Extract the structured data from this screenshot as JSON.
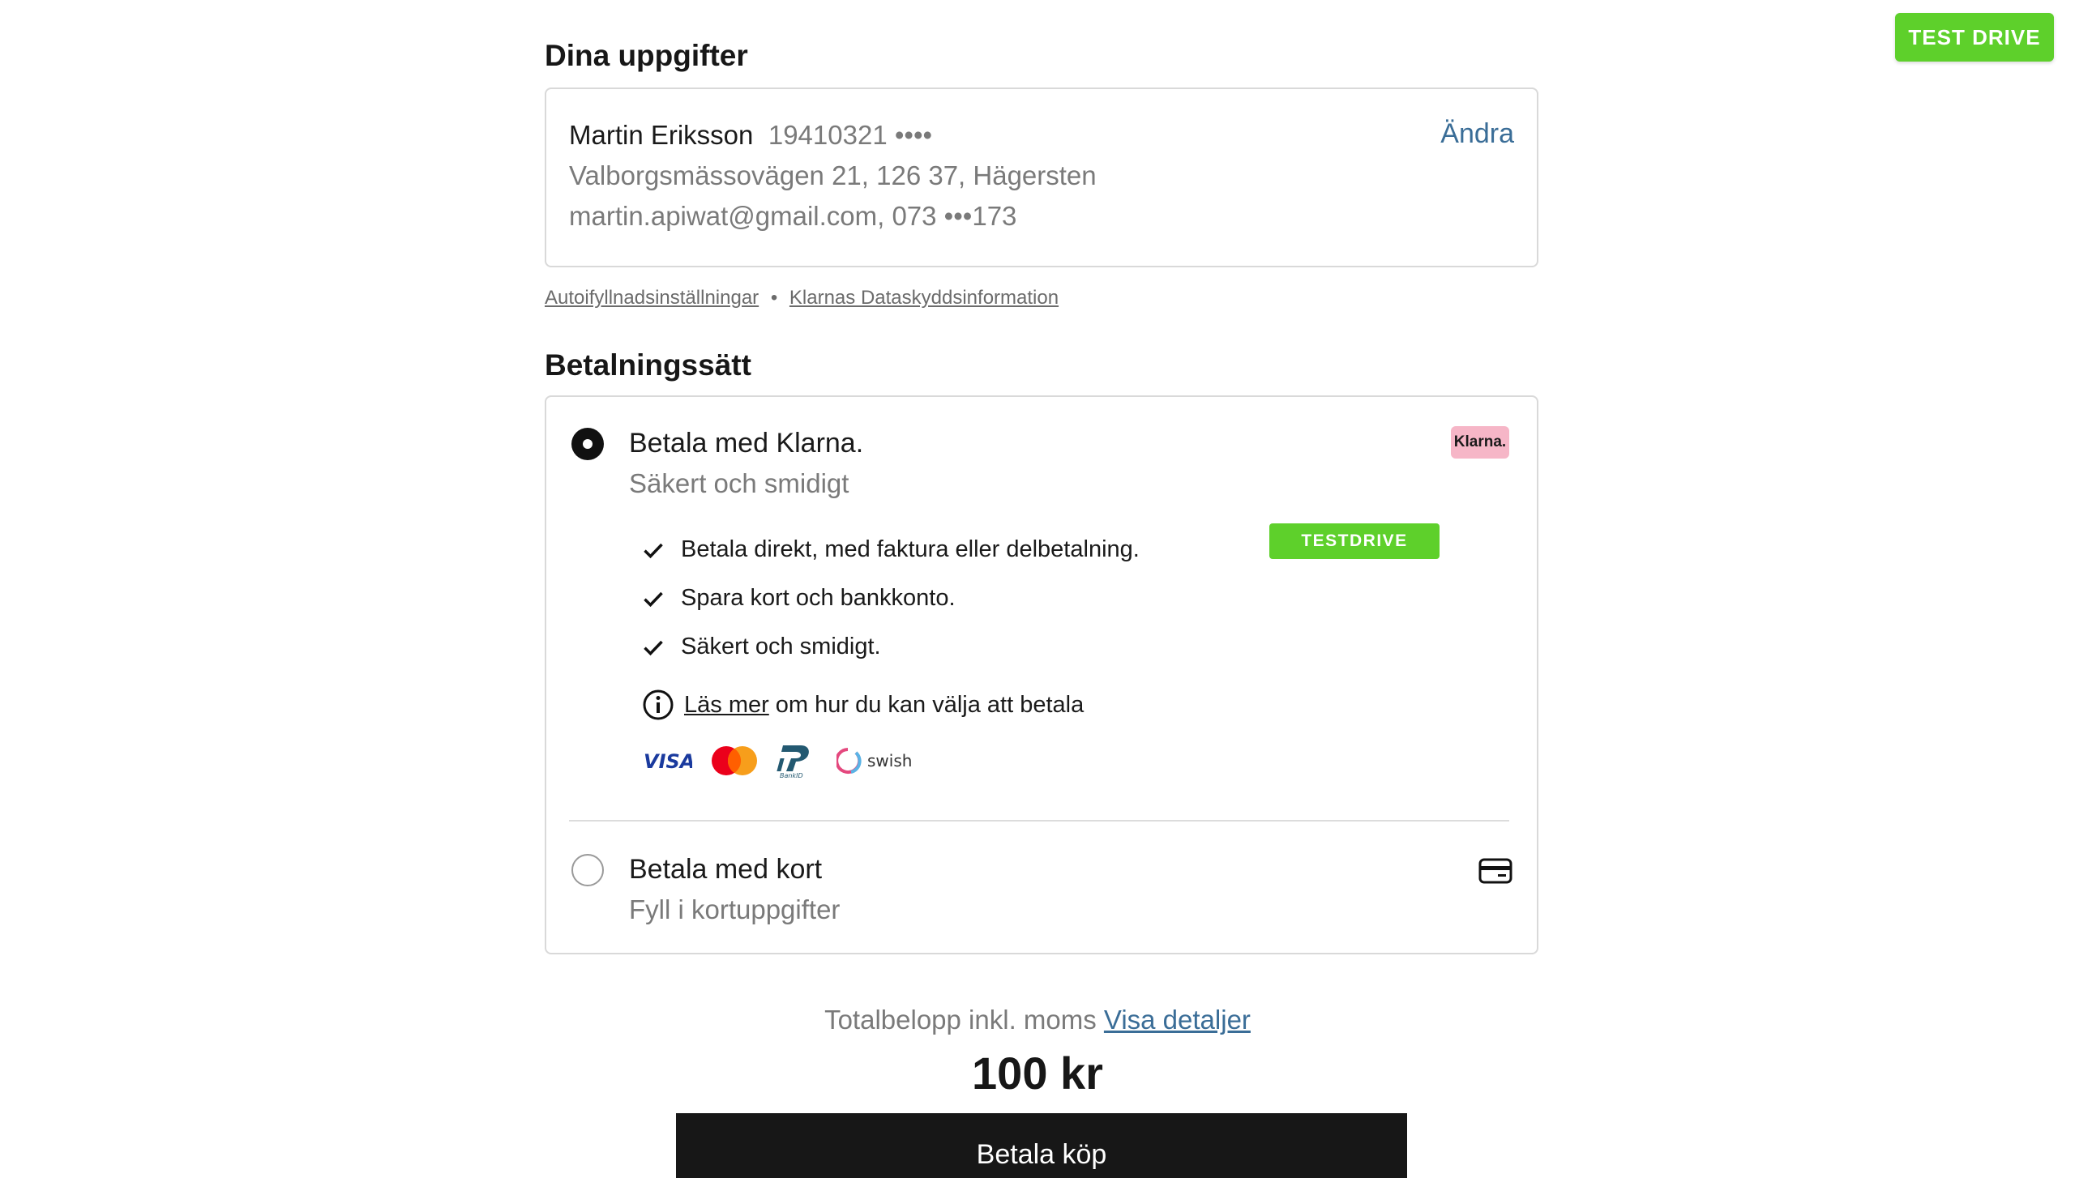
{
  "test_drive_label": "TEST DRIVE",
  "details": {
    "title": "Dina uppgifter",
    "name": "Martin Eriksson",
    "personal_number": "19410321 ••••",
    "address": "Valborgsmässovägen 21, 126 37, Hägersten",
    "contact": "martin.apiwat@gmail.com, 073 •••173",
    "edit_label": "Ändra"
  },
  "links": {
    "autofill": "Autoifyllnadsinställningar",
    "separator": "•",
    "privacy": "Klarnas Dataskyddsinformation"
  },
  "payment": {
    "title": "Betalningssätt",
    "klarna": {
      "title": "Betala med Klarna.",
      "subtitle": "Säkert och smidigt",
      "badge": "Klarna.",
      "testdrive_badge": "TESTDRIVE",
      "selected": true,
      "features": [
        "Betala direkt, med faktura eller delbetalning.",
        "Spara kort och bankkonto.",
        "Säkert och smidigt."
      ],
      "info_link": "Läs mer",
      "info_text": "om hur du kan välja att betala",
      "logos": [
        "VISA",
        "mastercard",
        "BankID",
        "swish"
      ]
    },
    "card": {
      "title": "Betala med kort",
      "subtitle": "Fyll i kortuppgifter",
      "selected": false
    }
  },
  "total": {
    "label": "Totalbelopp inkl. moms",
    "details_link": "Visa detaljer",
    "amount": "100 kr"
  },
  "pay_button": "Betala köp",
  "colors": {
    "accent_green": "#5ed02b",
    "link_blue": "#3a6d97",
    "klarna_pink": "#f6b6c7",
    "button_dark": "#171717"
  }
}
